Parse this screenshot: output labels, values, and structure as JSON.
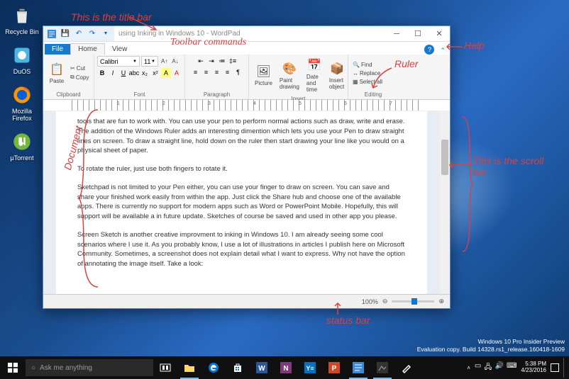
{
  "desktop": {
    "icons": [
      {
        "label": "Recycle Bin",
        "name": "recycle-bin-icon"
      },
      {
        "label": "DuOS",
        "name": "duos-icon"
      },
      {
        "label": "Mozilla Firefox",
        "name": "firefox-icon"
      },
      {
        "label": "µTorrent",
        "name": "utorrent-icon"
      }
    ]
  },
  "window": {
    "title": "using Inking in Windows 10 - WordPad",
    "tabs": {
      "file": "File",
      "home": "Home",
      "view": "View"
    },
    "ribbon": {
      "clipboard": {
        "label": "Clipboard",
        "paste": "Paste",
        "cut": "Cut",
        "copy": "Copy"
      },
      "font": {
        "label": "Font",
        "name": "Calibri",
        "size": "11"
      },
      "paragraph": {
        "label": "Paragraph"
      },
      "insert": {
        "label": "Insert",
        "picture": "Picture",
        "paint": "Paint drawing",
        "date": "Date and time",
        "object": "Insert object"
      },
      "editing": {
        "label": "Editing",
        "find": "Find",
        "replace": "Replace",
        "selectall": "Select all"
      }
    },
    "document": {
      "p1": "tools that are fun to work with. You can use your pen to perform normal actions such as draw, write and erase. The addition of the Windows Ruler adds an interesting dimention which lets you use your Pen to draw straight lines on screen. To draw a straight line, hold down on the ruler then start drawing your line like you would on a physical sheet of paper.",
      "p2": "To rotate the ruler, just use both fingers to rotate it.",
      "p3": "Sketchpad is not limited to your Pen either, you can use your finger to draw on screen. You can save and share your finished work easily from within the app. Just click the Share hub and choose one of the available apps. There is currently no support for modern apps such as Word or PowerPoint Mobile. Hopefully, this will support will be available a in future update. Sketches of course be saved and used in other app you please.",
      "p4": "Screen Sketch is another creative improvment to inking in Windows 10. I am already seeing some cool scenarios where I use it. As you probably know, I use a lot of illustrations in articles I publish here on Microsoft Community. Sometimes, a screenshot does not explain detail what I want to express. Why not have the option of annotating the image itself. Take a look:"
    },
    "status": {
      "zoom": "100%"
    }
  },
  "annotations": {
    "titlebar": "This is the title bar",
    "toolbar": "Toolbar commands",
    "help": "Help",
    "ruler": "Ruler",
    "document": "Document",
    "scrollbar": "This is the scroll bar",
    "statusbar": "status bar"
  },
  "taskbar": {
    "search_placeholder": "Ask me anything"
  },
  "tray": {
    "line1": "Windows 10 Pro Insider Preview",
    "line2": "Evaluation copy. Build 14328.rs1_release.160418-1609",
    "time": "5:38 PM",
    "date": "4/23/2016"
  }
}
